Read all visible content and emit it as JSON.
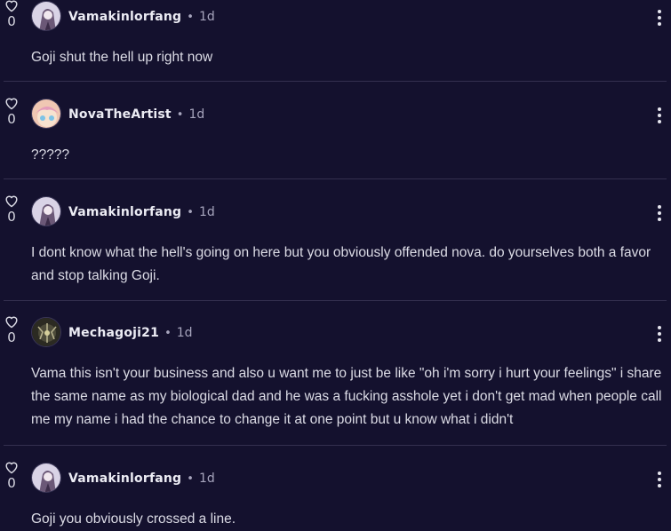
{
  "comments": [
    {
      "user": "Vamakinlorfang",
      "time": "1d",
      "likes": "0",
      "text": "Goji shut the hell up right now",
      "avatar": "vamakinlorfang"
    },
    {
      "user": "NovaTheArtist",
      "time": "1d",
      "likes": "0",
      "text": "?????",
      "avatar": "novatheartist"
    },
    {
      "user": "Vamakinlorfang",
      "time": "1d",
      "likes": "0",
      "text": "I dont know what the hell's going on here but you obviously offended nova. do yourselves both a favor and stop talking Goji.",
      "avatar": "vamakinlorfang"
    },
    {
      "user": "Mechagoji21",
      "time": "1d",
      "likes": "0",
      "text": "Vama this isn't your business and also u want me to just be like \"oh i'm sorry i hurt your feelings\" i share the same name as my biological dad and he was a fucking asshole yet i don't get mad when people call me my name i had the chance to change it at one point but u know what i didn't",
      "avatar": "mechagoji21"
    },
    {
      "user": "Vamakinlorfang",
      "time": "1d",
      "likes": "0",
      "text": "Goji you obviously crossed a line.",
      "avatar": "vamakinlorfang"
    }
  ],
  "separator": "•",
  "icons": {
    "like": "heart-outline-icon",
    "menu": "vertical-ellipsis-icon"
  },
  "colors": {
    "background": "#14112e",
    "divider": "#34304f",
    "muted": "#a7a5bd"
  }
}
